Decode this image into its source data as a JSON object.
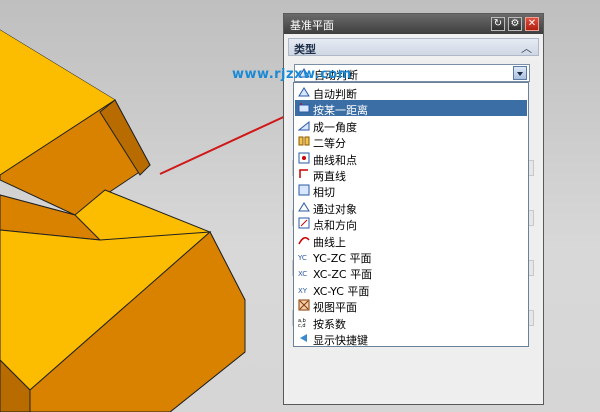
{
  "watermark": "www.rjzxw.com",
  "dialog": {
    "title": "基准平面",
    "section_label": "类型",
    "selected_value": "自动判断"
  },
  "dropdown": {
    "options": [
      {
        "label": "自动判断",
        "icon": "auto-infer-icon"
      },
      {
        "label": "按某一距离",
        "icon": "offset-distance-icon",
        "selected": true
      },
      {
        "label": "成一角度",
        "icon": "angle-icon"
      },
      {
        "label": "二等分",
        "icon": "bisector-icon"
      },
      {
        "label": "曲线和点",
        "icon": "curve-point-icon"
      },
      {
        "label": "两直线",
        "icon": "two-lines-icon"
      },
      {
        "label": "相切",
        "icon": "tangent-icon"
      },
      {
        "label": "通过对象",
        "icon": "through-object-icon"
      },
      {
        "label": "点和方向",
        "icon": "point-direction-icon"
      },
      {
        "label": "曲线上",
        "icon": "on-curve-icon"
      },
      {
        "label": "YC-ZC 平面",
        "icon": "yc-zc-plane-icon"
      },
      {
        "label": "XC-ZC 平面",
        "icon": "xc-zc-plane-icon"
      },
      {
        "label": "XC-YC 平面",
        "icon": "xc-yc-plane-icon"
      },
      {
        "label": "视图平面",
        "icon": "view-plane-icon"
      },
      {
        "label": "按系数",
        "icon": "coefficients-icon"
      },
      {
        "label": "显示快捷键",
        "icon": "show-shortcuts-icon"
      }
    ]
  },
  "colors": {
    "solid_top": "#fcbd00",
    "solid_front": "#d98200",
    "highlight": "#3a6ea5",
    "arrow": "#d01818"
  }
}
